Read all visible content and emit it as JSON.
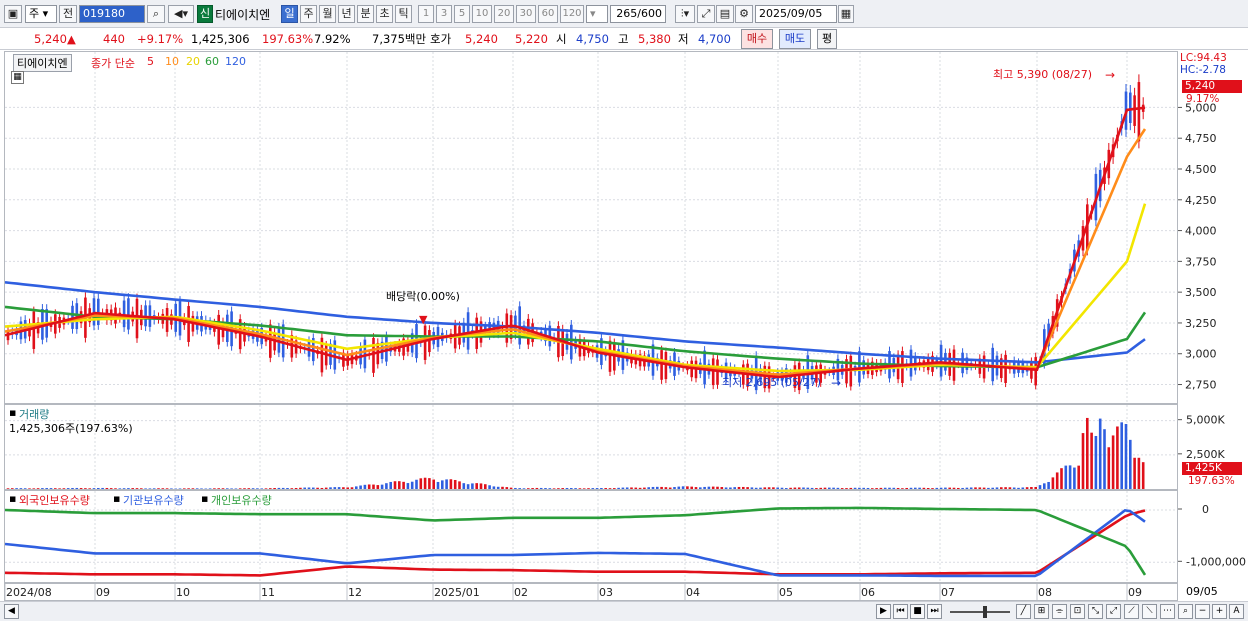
{
  "toolbar": {
    "market": "주",
    "prev": "전",
    "code": "019180",
    "new_badge": "신",
    "name": "티에이치엔",
    "period_tabs": [
      "일",
      "주",
      "월",
      "년",
      "분",
      "초",
      "틱"
    ],
    "selected_period": "일",
    "intervals": [
      "1",
      "3",
      "5",
      "10",
      "20",
      "30",
      "60",
      "120"
    ],
    "count": "265",
    "count_max": "/600",
    "date": "2025/09/05"
  },
  "quote": {
    "price": "5,240",
    "arrow": "▲",
    "change": "440",
    "change_pct": "+9.17%",
    "volume": "1,425,306",
    "volume_pct": "197.63%",
    "turnover_pct": "7.92%",
    "amount": "7,375백만",
    "ask_label": "호가",
    "ask1": "5,240",
    "ask2": "5,220",
    "open_label": "시",
    "open": "4,750",
    "high_label": "고",
    "high": "5,380",
    "low_label": "저",
    "low": "4,700",
    "buy": "매수",
    "sell": "매도",
    "eval": "평"
  },
  "price_panel": {
    "name": "티에이치엔",
    "ma_title": "종가 단순",
    "ma_periods": [
      "5",
      "10",
      "20",
      "60",
      "120"
    ],
    "lc": "LC:94.43",
    "hc": "HC:-2.78",
    "last_price": "5,240",
    "last_pct": "9.17%",
    "high_note": "최고 5,390 (08/27)",
    "low_note": "최저 2,695 (05/27)",
    "dividend_note": "배당락(0.00%)"
  },
  "volume_panel": {
    "title": "거래량",
    "value": "1,425,306주(197.63%)",
    "last": "1,425K",
    "last_pct": "197.63%"
  },
  "holding_panel": {
    "foreign": "외국인보유수량",
    "institution": "기관보유수량",
    "individual": "개인보유수량"
  },
  "x_axis": {
    "labels": [
      "2024/08",
      "09",
      "10",
      "11",
      "12",
      "2025/01",
      "02",
      "03",
      "04",
      "05",
      "06",
      "07",
      "08",
      "09"
    ],
    "end_label": "09/05"
  },
  "chart_data": [
    {
      "type": "line",
      "title": "티에이치엔",
      "x": [
        "2024/08",
        "09",
        "10",
        "11",
        "12",
        "2025/01",
        "02",
        "03",
        "04",
        "05",
        "06",
        "07",
        "08",
        "09",
        "09/05"
      ],
      "ylim": [
        2600,
        5450
      ],
      "yticks": [
        2750,
        3000,
        3250,
        3500,
        3750,
        4000,
        4250,
        4500,
        4750,
        5000
      ],
      "series": [
        {
          "name": "5",
          "color": "#e0101a",
          "values": [
            3150,
            3330,
            3280,
            3140,
            2950,
            3120,
            3230,
            3010,
            2890,
            2810,
            2880,
            2930,
            2870,
            4980,
            5000
          ]
        },
        {
          "name": "10",
          "color": "#ff8c1a",
          "values": [
            3180,
            3310,
            3290,
            3160,
            2990,
            3130,
            3200,
            3020,
            2900,
            2830,
            2880,
            2920,
            2880,
            4600,
            4850
          ]
        },
        {
          "name": "20",
          "color": "#f2e600",
          "values": [
            3220,
            3280,
            3300,
            3190,
            3040,
            3130,
            3170,
            3040,
            2910,
            2860,
            2870,
            2910,
            2890,
            3750,
            4270
          ]
        },
        {
          "name": "60",
          "color": "#2a9d3a",
          "values": [
            3380,
            3300,
            3280,
            3230,
            3150,
            3140,
            3140,
            3100,
            3020,
            2960,
            2920,
            2900,
            2890,
            3120,
            3360
          ]
        },
        {
          "name": "120",
          "color": "#2f5fe0",
          "values": [
            3580,
            3500,
            3440,
            3380,
            3300,
            3250,
            3220,
            3170,
            3100,
            3050,
            3000,
            2960,
            2930,
            3010,
            3130
          ]
        }
      ],
      "annotations": [
        "최고 5,390 (08/27)",
        "최저 2,695 (05/27)",
        "배당락(0.00%)"
      ]
    },
    {
      "type": "bar",
      "title": "거래량",
      "ylim": [
        0,
        6000
      ],
      "yticks": [
        "2,500K",
        "5,000K"
      ],
      "series": [
        {
          "name": "거래량",
          "values": [
            60,
            80,
            50,
            60,
            150,
            900,
            80,
            70,
            200,
            120,
            90,
            100,
            150,
            5200,
            1425
          ]
        }
      ]
    },
    {
      "type": "line",
      "title": "보유수량",
      "yticks": [
        "0",
        "-1,000,000"
      ],
      "series": [
        {
          "name": "외국인보유수량",
          "color": "#e0101a",
          "values": [
            -1200000,
            -1230000,
            -1230000,
            -1250000,
            -1080000,
            -1140000,
            -1150000,
            -1180000,
            -1180000,
            -1230000,
            -1230000,
            -1210000,
            -1200000,
            -100000,
            0
          ]
        },
        {
          "name": "기관보유수량",
          "color": "#2f5fe0",
          "values": [
            -650000,
            -830000,
            -830000,
            -830000,
            -1020000,
            -860000,
            -860000,
            -820000,
            -840000,
            -1250000,
            -1250000,
            -1260000,
            -1260000,
            20000,
            -250000
          ]
        },
        {
          "name": "개인보유수량",
          "color": "#2a9d3a",
          "values": [
            0,
            -60000,
            -60000,
            -80000,
            -80000,
            -200000,
            -150000,
            -150000,
            -100000,
            30000,
            40000,
            20000,
            0,
            -700000,
            -1300000
          ]
        }
      ]
    }
  ]
}
